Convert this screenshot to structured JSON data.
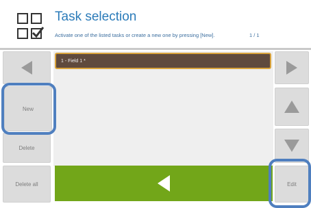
{
  "header": {
    "title": "Task selection",
    "subtitle": "Activate one of the listed tasks or create a new one by pressing [New].",
    "pager": "1 / 1"
  },
  "tasks": [
    {
      "label": "1 - Field 1  *"
    }
  ],
  "left_buttons": {
    "new_label": "New",
    "delete_label": "Delete",
    "delete_all_label": "Delete all"
  },
  "right_buttons": {
    "edit_label": "Edit"
  },
  "icons": {
    "app": "task-selection-icon",
    "prev": "left-arrow-icon",
    "next": "right-arrow-icon",
    "up": "up-arrow-icon",
    "down": "down-arrow-icon",
    "back": "back-arrow-icon"
  },
  "colors": {
    "accent": "#2b7bb9",
    "selected_row": "#5f4a3d",
    "selected_border": "#d9a33b",
    "back_button": "#72a619",
    "highlight": "#4f7fbf"
  }
}
